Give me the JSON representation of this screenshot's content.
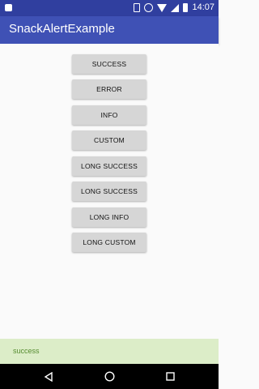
{
  "status_bar": {
    "time": "14:07",
    "icons": [
      "notification-icon",
      "vibrate-icon",
      "alarm-icon",
      "wifi-icon",
      "signal-icon",
      "battery-icon"
    ]
  },
  "app_bar": {
    "title": "SnackAlertExample",
    "color": "#3f51b5"
  },
  "buttons": [
    {
      "label": "SUCCESS"
    },
    {
      "label": "ERROR"
    },
    {
      "label": "INFO"
    },
    {
      "label": "CUSTOM"
    },
    {
      "label": "LONG SUCCESS"
    },
    {
      "label": "LONG SUCCESS"
    },
    {
      "label": "LONG INFO"
    },
    {
      "label": "LONG CUSTOM"
    }
  ],
  "snackbar": {
    "message": "success",
    "background": "#dcedc8",
    "text_color": "#558b2f"
  },
  "nav_bar": {
    "icons": [
      "back-icon",
      "home-icon",
      "recents-icon"
    ]
  }
}
